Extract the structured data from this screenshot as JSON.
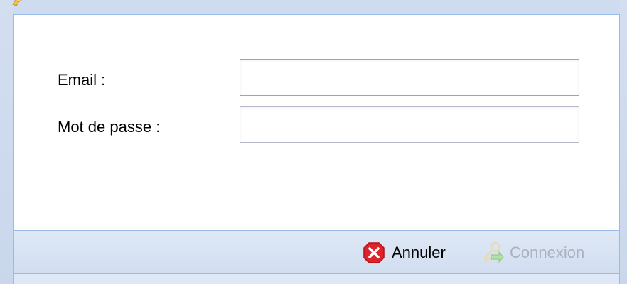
{
  "form": {
    "email_label": "Email :",
    "email_value": "",
    "password_label": "Mot de passe :",
    "password_value": ""
  },
  "footer": {
    "cancel_label": "Annuler",
    "login_label": "Connexion"
  },
  "icons": {
    "title": "pencil-icon",
    "cancel": "error-x-icon",
    "login": "keys-arrow-icon"
  },
  "colors": {
    "cancel_red": "#e0232b",
    "disabled_text": "#a9b2bf",
    "border_blue": "#99bbe8"
  }
}
